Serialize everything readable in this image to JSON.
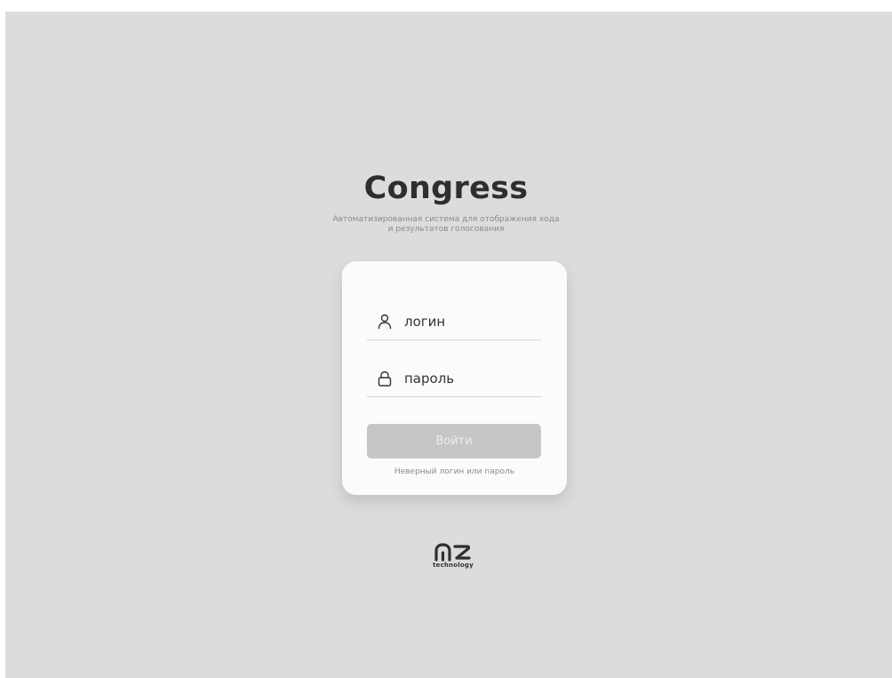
{
  "app": {
    "title": "Congress",
    "subtitle_line1": "Автоматизированная система для отображения хода",
    "subtitle_line2": "и результатов голосования"
  },
  "login_form": {
    "login_placeholder": "логин",
    "login_icon": "user-icon",
    "password_placeholder": "пароль",
    "password_icon": "lock-icon",
    "submit_label": "Войти",
    "error_message": "Неверный логин или пароль"
  },
  "footer": {
    "logo_text": "technology",
    "logo_icon": "m2-logo"
  },
  "colors": {
    "background": "#dcdcdc",
    "card": "#fbfbfb",
    "button_disabled": "#c6c6c6",
    "title": "#2e2e2e"
  }
}
